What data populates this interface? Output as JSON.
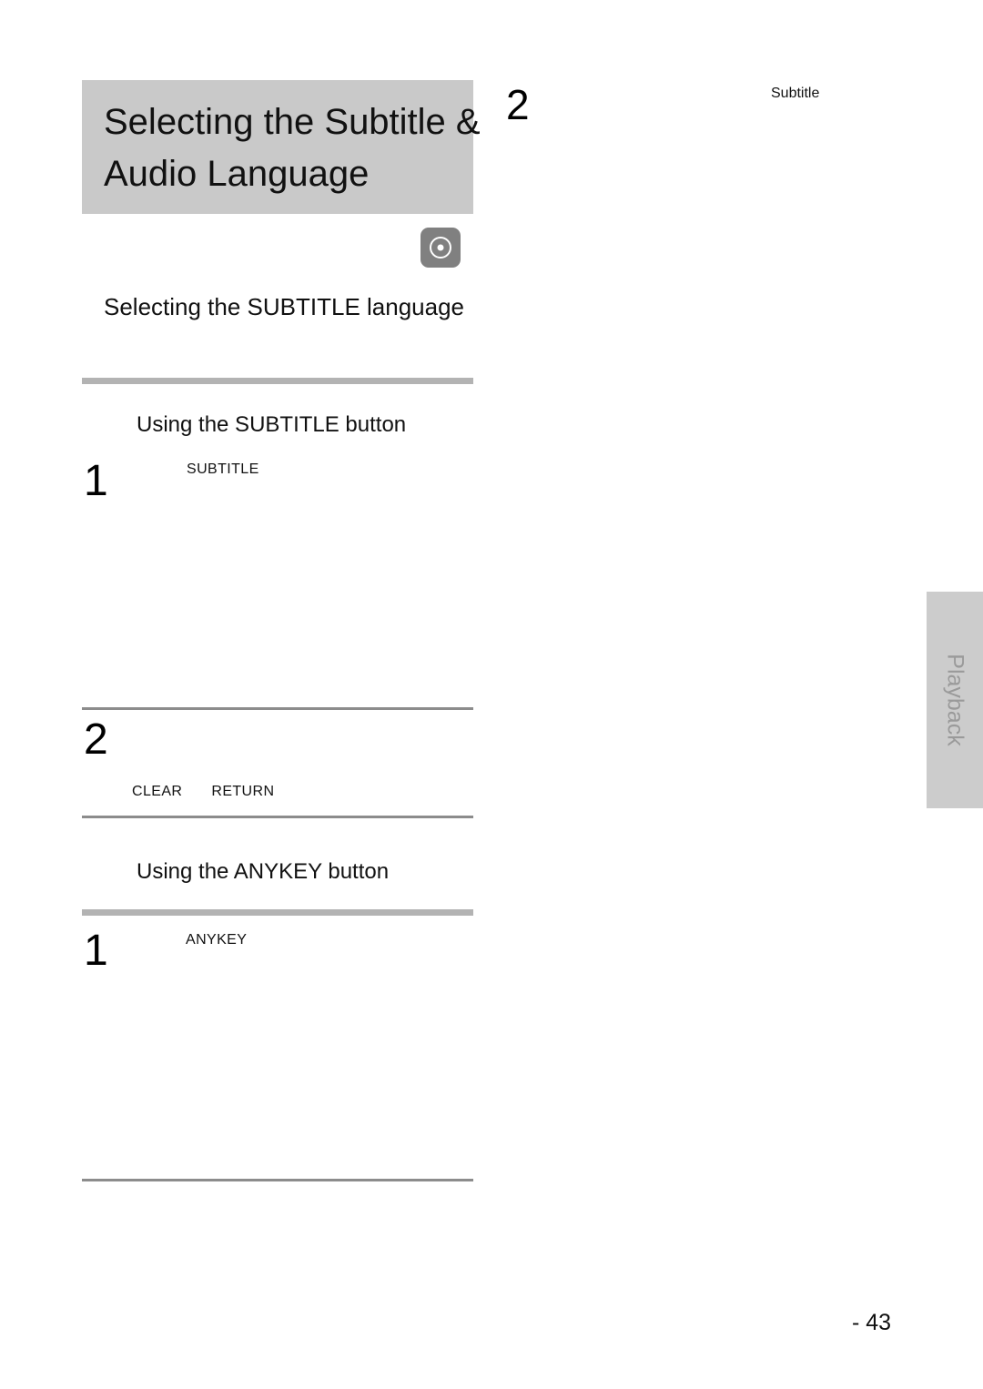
{
  "page": {
    "chapter_number": "2",
    "page_number": "- 43",
    "side_tab_label": "Playback"
  },
  "title_block": {
    "line1": "Selecting the Subtitle &",
    "line2": "Audio Language"
  },
  "icons": {
    "disc_icon": "disc-icon"
  },
  "section": {
    "heading": "Selecting the SUBTITLE language"
  },
  "subsections": [
    {
      "heading": "Using the SUBTITLE button",
      "steps": [
        {
          "number": "1",
          "keys": [
            "SUBTITLE"
          ]
        },
        {
          "number": "2",
          "keys": [
            "CLEAR",
            "RETURN"
          ]
        }
      ]
    },
    {
      "heading": "Using the ANYKEY button",
      "steps": [
        {
          "number": "1",
          "keys": [
            "ANYKEY"
          ]
        }
      ]
    }
  ],
  "annotations": {
    "right_note": "Subtitle"
  },
  "colors": {
    "title_block_bg": "#c9c9c9",
    "side_tab_bg": "#cccccc",
    "side_tab_text": "#9a9a9a",
    "rule_thick": "#b3b3b3",
    "rule_thin": "#8c8c8c",
    "disc_icon_bg": "#808080"
  }
}
